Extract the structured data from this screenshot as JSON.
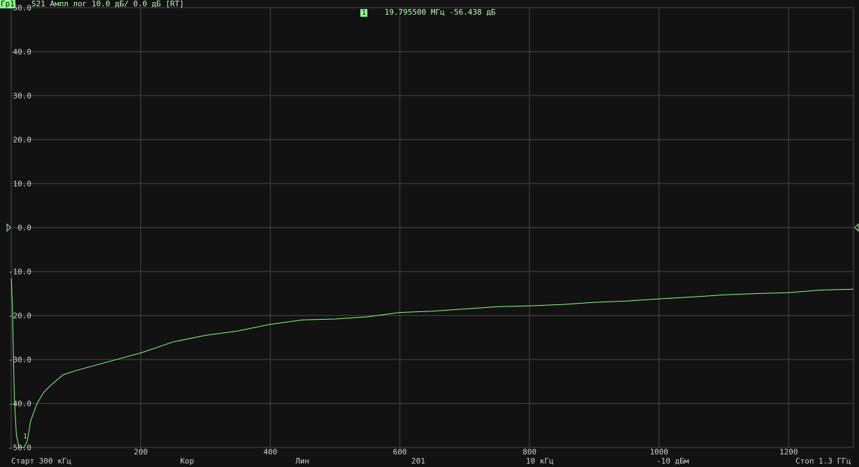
{
  "header": {
    "trace_tag": "Гр1",
    "trace_desc": "S21 Ампл лог 10.0 дБ/ 0.0 дБ [RT]"
  },
  "marker": {
    "number": "1",
    "readout": "19.795500 МГц -56.438 дБ",
    "label": "1"
  },
  "footer": {
    "start": "Старт 300 кГц",
    "cor": "Кор",
    "lin": "Лин",
    "points": "201",
    "ifbw": "10 кГц",
    "power": "-10 дБм",
    "stop": "Стоп 1.3 ГГц"
  },
  "colors": {
    "background": "#121212",
    "grid": "#4a4a4a",
    "trace": "#8cff8c",
    "text": "#cfcfcf"
  },
  "chart_data": {
    "type": "line",
    "title": "",
    "ylim": [
      -50,
      50
    ],
    "xlim": [
      0.3,
      1300
    ],
    "y_ticks": [
      "50.0",
      "40.0",
      "30.0",
      "20.0",
      "10.0",
      "0.0",
      "-10.0",
      "-20.0",
      "-30.0",
      "-40.0",
      "-50.0"
    ],
    "x_ticks": [
      "200",
      "400",
      "600",
      "800",
      "1000",
      "1200"
    ],
    "reference_level": 0,
    "grid": true,
    "series": [
      {
        "x": [
          0.3,
          2,
          5,
          8,
          12,
          15,
          19.8,
          25,
          30,
          40,
          50,
          60,
          80,
          100,
          150,
          200,
          250,
          300,
          350,
          400,
          450,
          500,
          550,
          600,
          650,
          700,
          750,
          800,
          850,
          900,
          950,
          1000,
          1050,
          1100,
          1150,
          1200,
          1250,
          1300
        ],
        "y": [
          -11.5,
          -19,
          -39,
          -47,
          -50.5,
          -53,
          -56.4,
          -48.5,
          -44,
          -40,
          -37.5,
          -36,
          -33.5,
          -32.5,
          -30.5,
          -28.5,
          -26,
          -24.5,
          -23.5,
          -22,
          -21,
          -20.8,
          -20.3,
          -19.3,
          -19,
          -18.5,
          -18,
          -17.8,
          -17.5,
          -17,
          -16.7,
          -16.2,
          -15.8,
          -15.3,
          -15,
          -14.8,
          -14.2,
          -14
        ]
      }
    ]
  }
}
